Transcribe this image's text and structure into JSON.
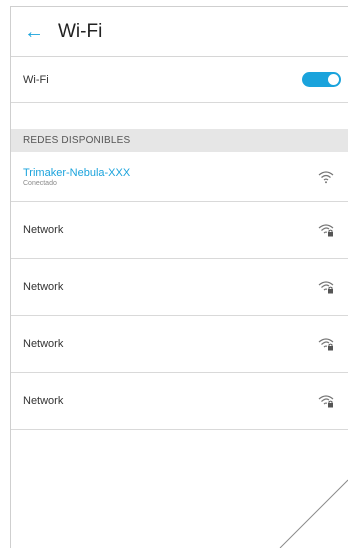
{
  "header": {
    "back_icon": "arrow-left-icon",
    "title": "Wi-Fi"
  },
  "wifi_toggle": {
    "label": "Wi-Fi",
    "enabled": true,
    "accent": "#1aa3dc"
  },
  "section": {
    "label": "REDES DISPONIBLES"
  },
  "networks": [
    {
      "name": "Trimaker-Nebula-XXX",
      "status": "Conectado",
      "icon": "wifi-icon",
      "locked": false
    },
    {
      "name": "Network",
      "icon": "wifi-lock-icon",
      "locked": true
    },
    {
      "name": "Network",
      "icon": "wifi-lock-icon",
      "locked": true
    },
    {
      "name": "Network",
      "icon": "wifi-lock-icon",
      "locked": true
    },
    {
      "name": "Network",
      "icon": "wifi-lock-icon",
      "locked": true
    }
  ]
}
